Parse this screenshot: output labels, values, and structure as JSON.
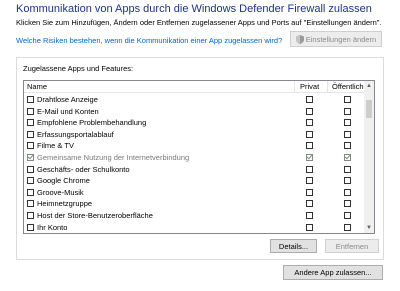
{
  "header": {
    "title": "Kommunikation von Apps durch die Windows Defender Firewall zulassen",
    "subtitle": "Klicken Sie zum Hinzufügen, Ändern oder Entfernen zugelassener Apps und Ports auf \"Einstellungen ändern\".",
    "risk_link": "Welche Risiken bestehen, wenn die Kommunikation einer App zugelassen wird?",
    "settings_button": "Einstellungen ändern"
  },
  "group": {
    "label": "Zugelassene Apps und Features:",
    "columns": {
      "name": "Name",
      "private": "Privat",
      "public": "Öffentlich"
    },
    "items": [
      {
        "label": "Drahtlose Anzeige",
        "checked": false,
        "private": false,
        "public": false
      },
      {
        "label": "E-Mail und Konten",
        "checked": false,
        "private": false,
        "public": false
      },
      {
        "label": "Empfohlene Problembehandlung",
        "checked": false,
        "private": false,
        "public": false
      },
      {
        "label": "Erfassungsportalablauf",
        "checked": false,
        "private": false,
        "public": false
      },
      {
        "label": "Filme & TV",
        "checked": false,
        "private": false,
        "public": false
      },
      {
        "label": "Gemeinsame Nutzung der Internetverbindung",
        "checked": true,
        "private": true,
        "public": true
      },
      {
        "label": "Geschäfts- oder Schulkonto",
        "checked": false,
        "private": false,
        "public": false
      },
      {
        "label": "Google Chrome",
        "checked": false,
        "private": false,
        "public": false
      },
      {
        "label": "Groove-Musik",
        "checked": false,
        "private": false,
        "public": false
      },
      {
        "label": "Heimnetzgruppe",
        "checked": false,
        "private": false,
        "public": false
      },
      {
        "label": "Host der Store-Benutzeroberfläche",
        "checked": false,
        "private": false,
        "public": false
      },
      {
        "label": "Ihr Konto",
        "checked": false,
        "private": false,
        "public": false
      }
    ],
    "details_button": "Details...",
    "remove_button": "Entfernen"
  },
  "footer": {
    "add_app_button": "Andere App zulassen..."
  },
  "colors": {
    "title": "#1e3287",
    "link": "#0066cc"
  }
}
